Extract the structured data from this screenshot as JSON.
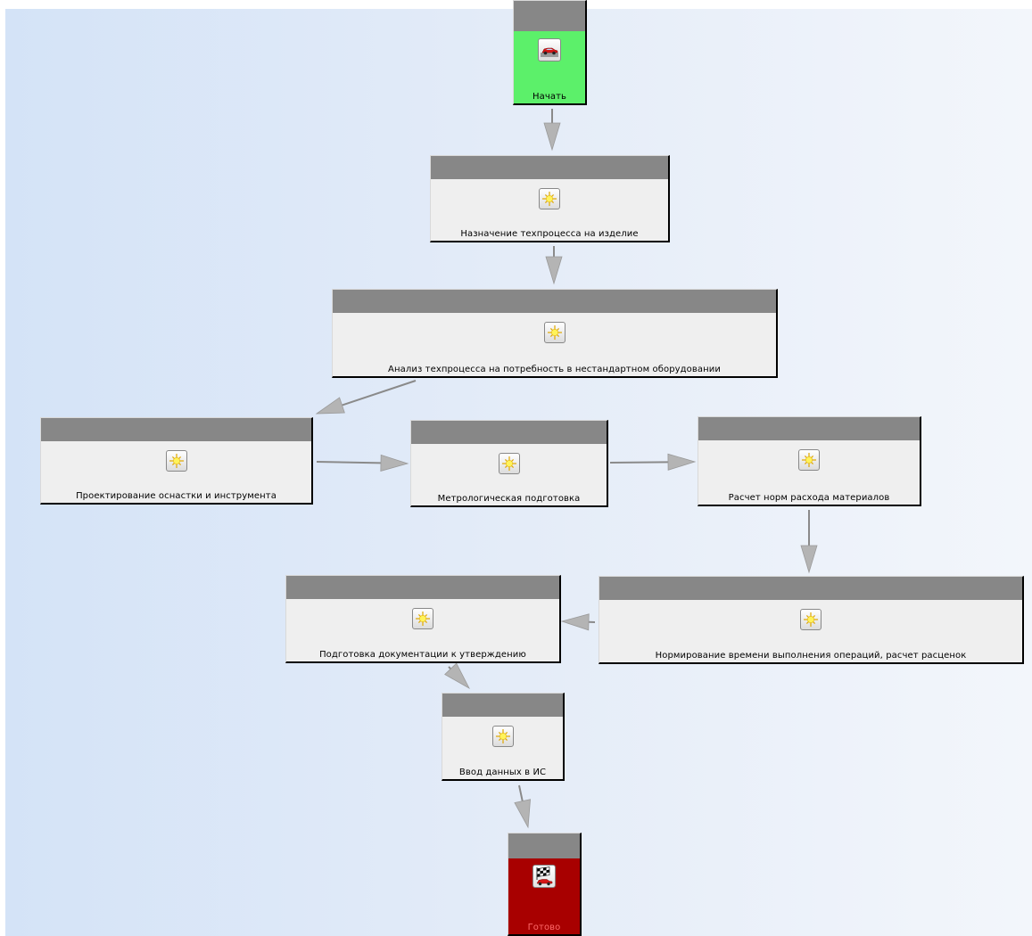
{
  "diagram": {
    "nodes": {
      "start": {
        "label": "Начать",
        "icon": "car-icon"
      },
      "assign": {
        "label": "Назначение техпроцесса на изделие",
        "icon": "sparkle-icon"
      },
      "analysis": {
        "label": "Анализ техпроцесса на потребность в нестандартном оборудовании",
        "icon": "sparkle-icon"
      },
      "design": {
        "label": "Проектирование оснастки и инструмента",
        "icon": "sparkle-icon"
      },
      "metrology": {
        "label": "Метрологическая подготовка",
        "icon": "sparkle-icon"
      },
      "materials": {
        "label": "Расчет норм расхода материалов",
        "icon": "sparkle-icon"
      },
      "timing": {
        "label": "Нормирование времени выполнения операций, расчет расценок",
        "icon": "sparkle-icon"
      },
      "docs": {
        "label": "Подготовка документации к утверждению",
        "icon": "sparkle-icon"
      },
      "input": {
        "label": "Ввод данных в ИС",
        "icon": "sparkle-icon"
      },
      "finish": {
        "label": "Готово",
        "icon": "checkered-flag-car-icon"
      }
    },
    "edges": [
      [
        "start",
        "assign"
      ],
      [
        "assign",
        "analysis"
      ],
      [
        "analysis",
        "design"
      ],
      [
        "design",
        "metrology"
      ],
      [
        "metrology",
        "materials"
      ],
      [
        "materials",
        "timing"
      ],
      [
        "timing",
        "docs"
      ],
      [
        "docs",
        "input"
      ],
      [
        "input",
        "finish"
      ]
    ],
    "colors": {
      "start_fill": "#5cf06a",
      "finish_fill": "#a80000",
      "node_fill": "#efefef",
      "node_header": "#878787",
      "arrow": "#b4b4b4"
    }
  }
}
